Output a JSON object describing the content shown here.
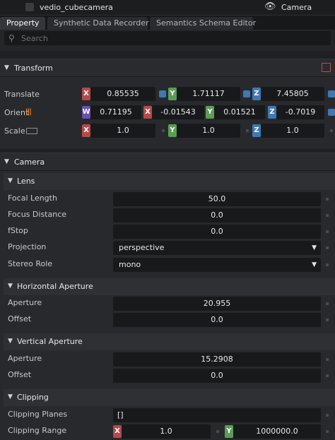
{
  "topbar": {
    "prim_name": "vedio_cubecamera",
    "prim_type": "Camera",
    "eye_icon": "eye-icon"
  },
  "tabs": [
    {
      "label": "Property",
      "active": true
    },
    {
      "label": "Synthetic Data Recorder",
      "active": false
    },
    {
      "label": "Semantics Schema Editor",
      "active": false
    }
  ],
  "search": {
    "placeholder": "Search"
  },
  "transform": {
    "title": "Transform",
    "translate": {
      "label": "Translate",
      "x": "0.85535",
      "y": "1.71117",
      "z": "7.45805"
    },
    "orient": {
      "label": "Orient",
      "w": "0.71195",
      "x": "-0.01543",
      "y": "0.01521",
      "z": "-0.7019"
    },
    "scale": {
      "label": "Scale",
      "x": "1.0",
      "y": "1.0",
      "z": "1.0"
    },
    "axis_labels": {
      "x": "X",
      "y": "Y",
      "z": "Z",
      "w": "W"
    }
  },
  "camera": {
    "title": "Camera",
    "lens": {
      "title": "Lens",
      "focal_length": {
        "label": "Focal Length",
        "value": "50.0"
      },
      "focus_distance": {
        "label": "Focus Distance",
        "value": "0.0"
      },
      "fstop": {
        "label": "fStop",
        "value": "0.0"
      },
      "projection": {
        "label": "Projection",
        "value": "perspective"
      },
      "stereo_role": {
        "label": "Stereo Role",
        "value": "mono"
      }
    },
    "horizontal_aperture": {
      "title": "Horizontal Aperture",
      "aperture": {
        "label": "Aperture",
        "value": "20.955"
      },
      "offset": {
        "label": "Offset",
        "value": "0.0"
      }
    },
    "vertical_aperture": {
      "title": "Vertical Aperture",
      "aperture": {
        "label": "Aperture",
        "value": "15.2908"
      },
      "offset": {
        "label": "Offset",
        "value": "0.0"
      }
    },
    "clipping": {
      "title": "Clipping",
      "planes": {
        "label": "Clipping Planes",
        "value": "[]"
      },
      "range": {
        "label": "Clipping Range",
        "x": "1.0",
        "y": "1000000.0"
      }
    }
  },
  "colors": {
    "axis_x": "#b54a4a",
    "axis_y": "#5a9e56",
    "axis_z": "#3f79b4",
    "axis_w": "#6a4fb4"
  }
}
